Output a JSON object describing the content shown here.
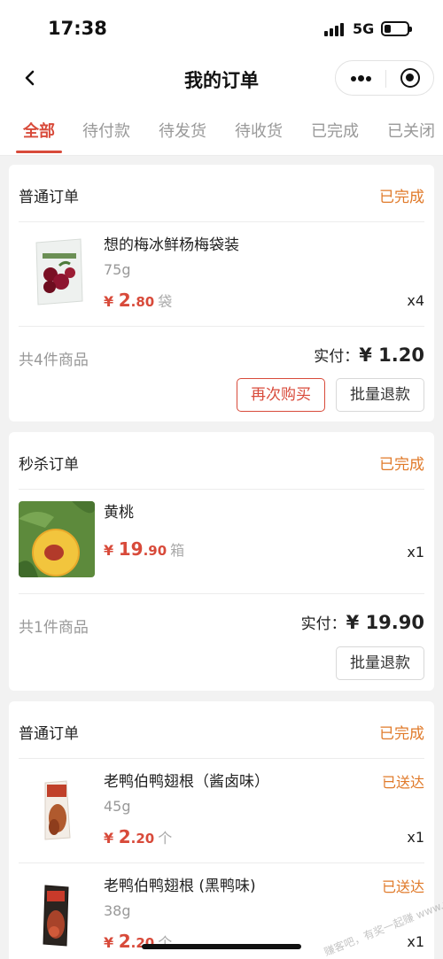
{
  "status_bar": {
    "time": "17:38",
    "network": "5G",
    "battery_level": 0.3
  },
  "nav": {
    "title": "我的订单",
    "back_icon": "chevron-left-icon",
    "more_icon": "more-dots-icon",
    "close_icon": "target-close-icon"
  },
  "tabs": [
    {
      "label": "全部",
      "active": true
    },
    {
      "label": "待付款"
    },
    {
      "label": "待发货"
    },
    {
      "label": "待收货"
    },
    {
      "label": "已完成"
    },
    {
      "label": "已关闭"
    }
  ],
  "orders": [
    {
      "type": "普通订单",
      "status": "已完成",
      "items": [
        {
          "name": "想的梅冰鲜杨梅袋装",
          "spec": "75g",
          "price_currency": "¥",
          "price_int": "2",
          "price_dec": ".80",
          "unit": "袋",
          "qty": "x4"
        }
      ],
      "count_text": "共4件商品",
      "paid_label": "实付：",
      "paid_amount": "¥ 1.20",
      "buttons": [
        "再次购买",
        "批量退款"
      ]
    },
    {
      "type": "秒杀订单",
      "status": "已完成",
      "items": [
        {
          "name": "黄桃",
          "spec": "",
          "price_currency": "¥",
          "price_int": "19",
          "price_dec": ".90",
          "unit": "箱",
          "qty": "x1"
        }
      ],
      "count_text": "共1件商品",
      "paid_label": "实付：",
      "paid_amount": "¥ 19.90",
      "buttons": [
        "批量退款"
      ]
    },
    {
      "type": "普通订单",
      "status": "已完成",
      "items": [
        {
          "name": "老鸭伯鸭翅根（酱卤味）",
          "spec": "45g",
          "price_currency": "¥",
          "price_int": "2",
          "price_dec": ".20",
          "unit": "个",
          "qty": "x1",
          "state": "已送达"
        },
        {
          "name": "老鸭伯鸭翅根 (黑鸭味)",
          "spec": "38g",
          "price_currency": "¥",
          "price_int": "2",
          "price_dec": ".20",
          "unit": "个",
          "qty": "x1",
          "state": "已送达"
        }
      ]
    }
  ],
  "watermark": "赚客吧，有奖一起赚 www.zuanke8.com",
  "colors": {
    "accent": "#d84a3a",
    "status": "#e07a2a",
    "background": "#f2f2f2"
  }
}
